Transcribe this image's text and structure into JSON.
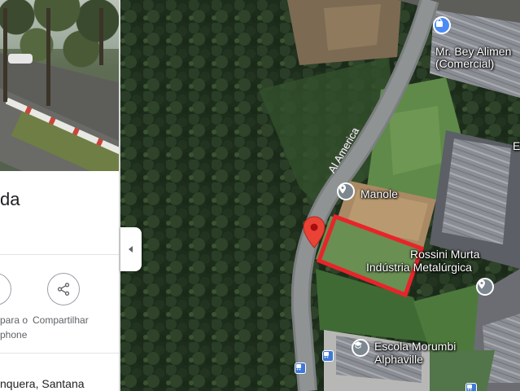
{
  "place_panel": {
    "title": "da",
    "actions": [
      {
        "label_line1": "para o",
        "label_line2": "phone",
        "icon": "send-to-phone-icon"
      },
      {
        "label_line1": "Compartilhar",
        "label_line2": "",
        "icon": "share-icon"
      }
    ],
    "address": "nquera, Santana",
    "collapse_icon": "chevron-left-icon"
  },
  "map": {
    "road_label": "Al America",
    "pin_color": "#ea4335",
    "boundary_color": "#e8242a",
    "places": [
      {
        "name_line1": "Mr. Bey Alimen",
        "name_line2": "(Comercial)",
        "icon": "shopping-bag-icon"
      },
      {
        "name_line1": "Manole",
        "name_line2": "",
        "icon": "map-pin-icon"
      },
      {
        "name_line1": "Rossini Murta",
        "name_line2": "Indústria Metalúrgica",
        "icon": "map-pin-icon"
      },
      {
        "name_line1": "Escola Morumbi",
        "name_line2": "Alphaville",
        "icon": "school-icon"
      },
      {
        "name_line1": "E",
        "name_line2": "",
        "icon": ""
      }
    ]
  }
}
